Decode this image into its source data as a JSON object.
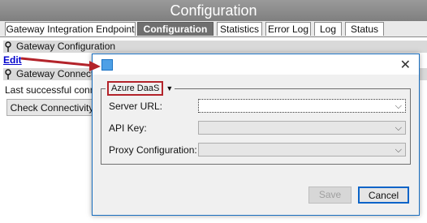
{
  "window": {
    "title": "Configuration"
  },
  "tabs": [
    {
      "label": "Gateway Integration Endpoint",
      "active": false
    },
    {
      "label": "Configuration",
      "active": true
    },
    {
      "label": "Statistics",
      "active": false
    },
    {
      "label": "Error Log",
      "active": false
    },
    {
      "label": "Log",
      "active": false
    },
    {
      "label": "Status",
      "active": false
    }
  ],
  "sections": {
    "gateway_configuration": "Gateway Configuration",
    "edit_link": "Edit",
    "gateway_connectivity": "Gateway Connectivity",
    "last_success": "Last successful connection",
    "check_button": "Check Connectivity"
  },
  "dialog": {
    "group_label": "Azure DaaS",
    "fields": [
      {
        "label": "Server URL:",
        "value": ""
      },
      {
        "label": "API Key:",
        "value": ""
      },
      {
        "label": "Proxy Configuration:",
        "value": ""
      }
    ],
    "save_label": "Save",
    "cancel_label": "Cancel"
  },
  "colors": {
    "accent": "#0a64c8",
    "annotation": "#b3232a",
    "title_bar": "#8a8a8a"
  },
  "icons": {
    "pin": "pin-icon",
    "app": "app-icon",
    "close": "close-icon",
    "dropdown": "chevron-down-icon"
  }
}
